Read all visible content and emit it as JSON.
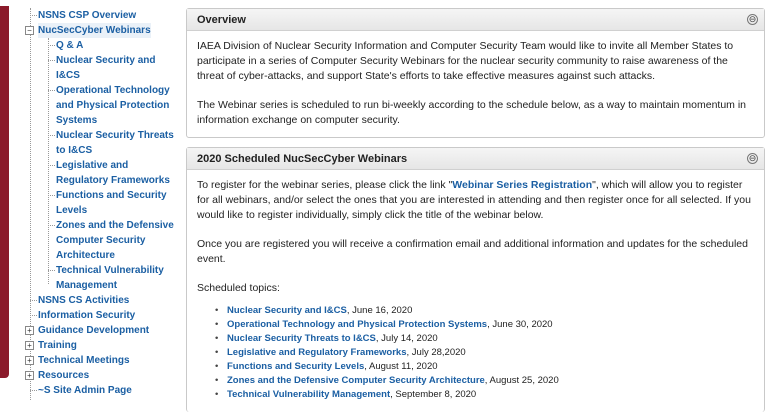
{
  "sidebar": {
    "items": [
      {
        "label": "NSNS CSP Overview"
      },
      {
        "label": "NucSecCyber Webinars"
      },
      {
        "label": "Q & A"
      },
      {
        "label": "Nuclear Security and I&CS"
      },
      {
        "label": "Operational Technology and Physical Protection Systems"
      },
      {
        "label": "Nuclear Security Threats to I&CS"
      },
      {
        "label": "Legislative and Regulatory Frameworks"
      },
      {
        "label": "Functions and Security Levels"
      },
      {
        "label": "Zones and the Defensive Computer Security Architecture"
      },
      {
        "label": "Technical Vulnerability Management"
      },
      {
        "label": "NSNS CS Activities"
      },
      {
        "label": "Information Security"
      },
      {
        "label": "Guidance Development"
      },
      {
        "label": "Training"
      },
      {
        "label": "Technical Meetings"
      },
      {
        "label": "Resources"
      },
      {
        "label": "~S Site Admin Page"
      }
    ]
  },
  "overview": {
    "title": "Overview",
    "p1": "IAEA Division of Nuclear Security Information and Computer Security Team would like to invite all Member States to participate in a series of Computer Security Webinars for the nuclear security community to raise awareness of the threat of cyber-attacks, and support State's efforts to take effective measures against such attacks.",
    "p2": "The Webinar series is scheduled to run bi-weekly according to the schedule below, as a way to maintain momentum in information exchange on computer security."
  },
  "webinars": {
    "title": "2020 Scheduled NucSecCyber Webinars",
    "reg_pre": "To register for the webinar series, please click the link \"",
    "reg_link": "Webinar Series Registration",
    "reg_post": "\", which will allow you to register for all webinars, and/or select the ones that you are interested in attending and then register once for all selected. If you would like to register individually, simply click the title of the webinar below.",
    "p2": "Once you are registered you will receive a confirmation email and additional information and updates for the scheduled event.",
    "p3": "Scheduled topics:",
    "topics": [
      {
        "title": "Nuclear Security and I&CS",
        "date": ", June 16, 2020"
      },
      {
        "title": "Operational Technology and Physical Protection Systems",
        "date": ", June 30, 2020"
      },
      {
        "title": "Nuclear Security Threats to I&CS",
        "date": ", July 14, 2020"
      },
      {
        "title": "Legislative and Regulatory Frameworks",
        "date": ", July 28,2020"
      },
      {
        "title": "Functions and Security Levels",
        "date": ", August 11, 2020"
      },
      {
        "title": "Zones and the Defensive Computer Security Architecture",
        "date": ", August 25, 2020"
      },
      {
        "title": "Technical Vulnerability Management",
        "date": ", September 8, 2020"
      }
    ]
  },
  "icons": {
    "collapse": "⊖",
    "expand": "+",
    "expanded": "−"
  },
  "colors": {
    "accent": "#8b1a2b",
    "link": "#1b5fa3"
  }
}
